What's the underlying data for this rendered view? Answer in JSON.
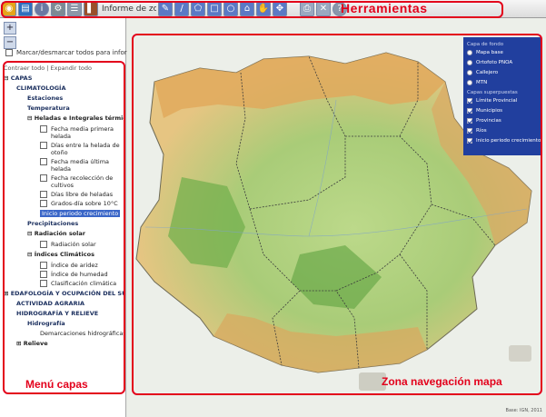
{
  "toolbar": {
    "title": "Herramientas",
    "report_text": "Informe de zona",
    "tools": [
      "globe",
      "layers",
      "info",
      "tools",
      "list",
      "report",
      "pencil",
      "line",
      "polygon",
      "rect",
      "circle",
      "home",
      "hand",
      "pan",
      "print",
      "delete",
      "help"
    ]
  },
  "left_panel": {
    "show_all_label": "Marcar/desmarcar todos para informe",
    "tree_title": "Contraer todo | Expandir todo",
    "nodes": [
      {
        "label": "CAPAS",
        "level": 0,
        "type": "expander",
        "expanded": true
      },
      {
        "label": "CLIMATOLOGÍA",
        "level": 1,
        "type": "bold"
      },
      {
        "label": "Estaciones",
        "level": 2,
        "type": "bold"
      },
      {
        "label": "Temperatura",
        "level": 2,
        "type": "bold"
      },
      {
        "label": "Heladas e Integrales térmicas",
        "level": 2,
        "type": "expander",
        "expanded": true
      },
      {
        "label": "Fecha media primera helada",
        "level": 3,
        "type": "leaf"
      },
      {
        "label": "Días entre la helada de otoño",
        "level": 3,
        "type": "leaf"
      },
      {
        "label": "Fecha media última helada",
        "level": 3,
        "type": "leaf"
      },
      {
        "label": "Fecha recolección de cultivos",
        "level": 3,
        "type": "leaf"
      },
      {
        "label": "Días libre de heladas",
        "level": 3,
        "type": "leaf"
      },
      {
        "label": "Grados-día sobre 10°C",
        "level": 3,
        "type": "leaf"
      },
      {
        "label": "Inicio periodo crecimiento",
        "level": 3,
        "type": "selected"
      },
      {
        "label": "Precipitaciones",
        "level": 2,
        "type": "bold"
      },
      {
        "label": "Radiación solar",
        "level": 2,
        "type": "expander",
        "expanded": true
      },
      {
        "label": "Radiación solar",
        "level": 3,
        "type": "leaf"
      },
      {
        "label": "Índices Climáticos",
        "level": 2,
        "type": "expander",
        "expanded": true
      },
      {
        "label": "Índice de aridez",
        "level": 3,
        "type": "leaf"
      },
      {
        "label": "Índice de humedad",
        "level": 3,
        "type": "leaf"
      },
      {
        "label": "Clasificación climática",
        "level": 3,
        "type": "leaf"
      },
      {
        "label": "EDAFOLOGÍA Y OCUPACIÓN DEL SUELO",
        "level": 0,
        "type": "expander",
        "expanded": false
      },
      {
        "label": "ACTIVIDAD AGRARIA",
        "level": 1,
        "type": "bold"
      },
      {
        "label": "HIDROGRAFÍA Y RELIEVE",
        "level": 1,
        "type": "bold"
      },
      {
        "label": "Hidrografía",
        "level": 2,
        "type": "bold"
      },
      {
        "label": "Demarcaciones hidrográficas",
        "level": 3,
        "type": "plain"
      },
      {
        "label": "Relieve",
        "level": 1,
        "type": "expander",
        "expanded": false
      }
    ],
    "label": "Menú capas"
  },
  "map": {
    "zone_label": "Zona navegación mapa",
    "attribution": "Base: IGN, 2011",
    "overlay": {
      "base_header": "Capa de fondo",
      "base_layers": [
        "Mapa base",
        "Ortofoto PNOA",
        "Callejero",
        "MTN"
      ],
      "data_header": "Capas superpuestas",
      "data_layers": [
        {
          "label": "Límite Provincial",
          "checked": true
        },
        {
          "label": "Municipios",
          "checked": true
        },
        {
          "label": "Provincias",
          "checked": true
        },
        {
          "label": "Ríos",
          "checked": true
        },
        {
          "label": "Inicio periodo crecimiento",
          "checked": true
        }
      ]
    }
  },
  "colors": {
    "accent": "#e3001b",
    "panel_blue": "#213f9e"
  }
}
